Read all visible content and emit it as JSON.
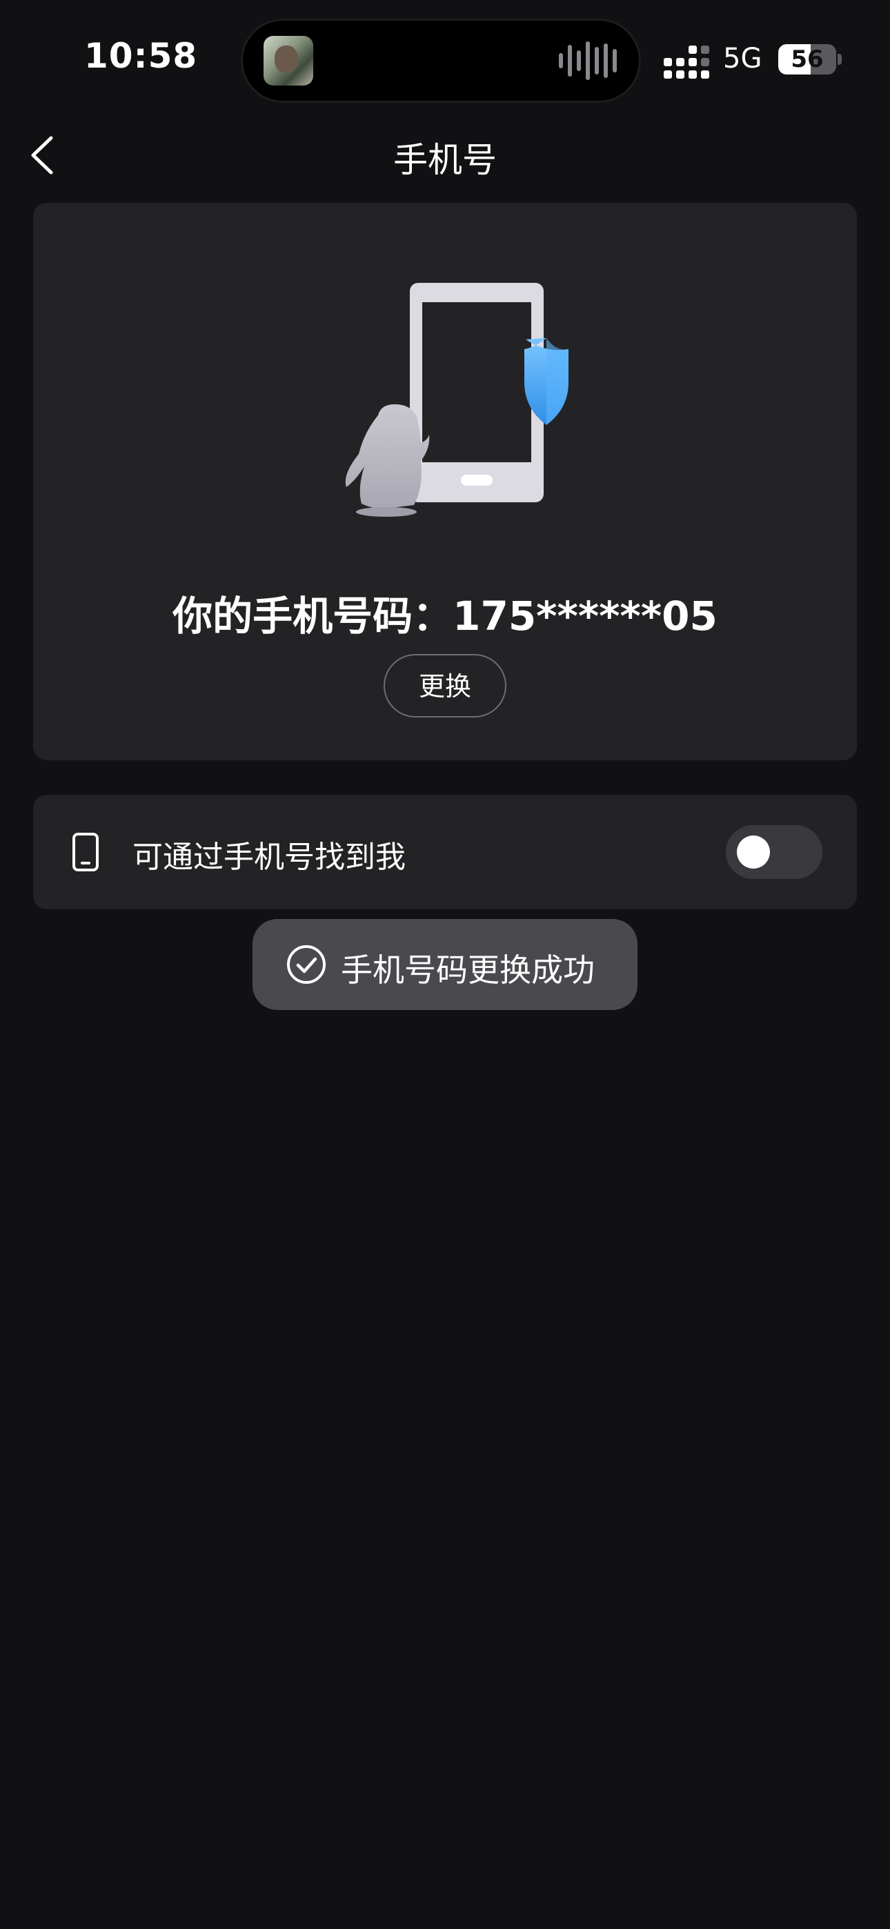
{
  "status_bar": {
    "time": "10:58",
    "network": "5G",
    "battery_level": "56",
    "battery_fraction": 0.56
  },
  "nav": {
    "title": "手机号",
    "back_icon": "chevron-left-icon"
  },
  "phone_card": {
    "illustration": "phone-shield-penguin-illustration",
    "number_label": "你的手机号码：175******05",
    "change_button_label": "更换"
  },
  "settings": {
    "find_me_by_phone": {
      "icon": "mobile-phone-icon",
      "label": "可通过手机号找到我",
      "enabled": false
    }
  },
  "toast": {
    "icon": "check-circle-icon",
    "message": "手机号码更换成功"
  },
  "colors": {
    "background": "#111113",
    "card": "#232326",
    "toast": "#4a4a4e",
    "shield_blue": "#4aa8f5",
    "toggle_off": "#3a3a3e"
  }
}
